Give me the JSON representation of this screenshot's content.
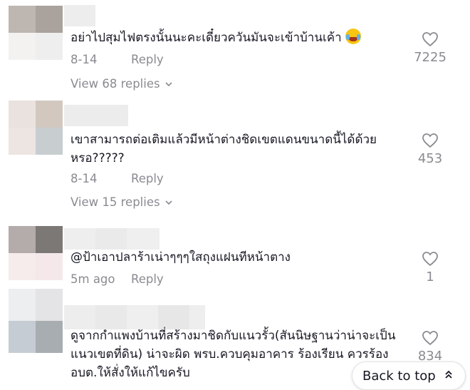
{
  "comments": [
    {
      "text": "อย่าไปสุมไฟตรงนั้นนะคะเดี๋ยวควันมันจะเข้าบ้านเค้า",
      "emoji": "rolling-laughing-emoji",
      "date": "8-14",
      "reply_label": "Reply",
      "likes": "7225",
      "view_replies": "View 68 replies"
    },
    {
      "text": "เขาสามารถต่อเติมแล้วมีหน้าต่างชิดเขตแดนขนาดนี้ได้ด้วยหรอ?????",
      "date": "8-14",
      "reply_label": "Reply",
      "likes": "453",
      "view_replies": "View 15 replies"
    },
    {
      "text": "@ป้าเอาปลาร้าเน่าๆๆๆใสถุงแฝนทีหน้าตาง",
      "date": "5m ago",
      "reply_label": "Reply",
      "likes": "1"
    },
    {
      "text": "ดูจากกำแพงบ้านที่สร้างมาชิดกับแนวรั้ว(สันนิษฐานว่าน่าจะเป็นแนวเขตที่ดิน) น่าจะผิด พรบ.ควบคุมอาคาร ร้องเรียน ควรร้อง อบต.ให้สั่งให้แก้ไขครับ",
      "likes": "834"
    }
  ],
  "back_to_top_label": "Back to top",
  "colors": {
    "text": "#161823",
    "secondary": "#8a8b91"
  },
  "icons": {
    "like": "heart-outline-icon",
    "expand": "chevron-down-icon",
    "back_to_top": "double-chevron-up-icon"
  }
}
